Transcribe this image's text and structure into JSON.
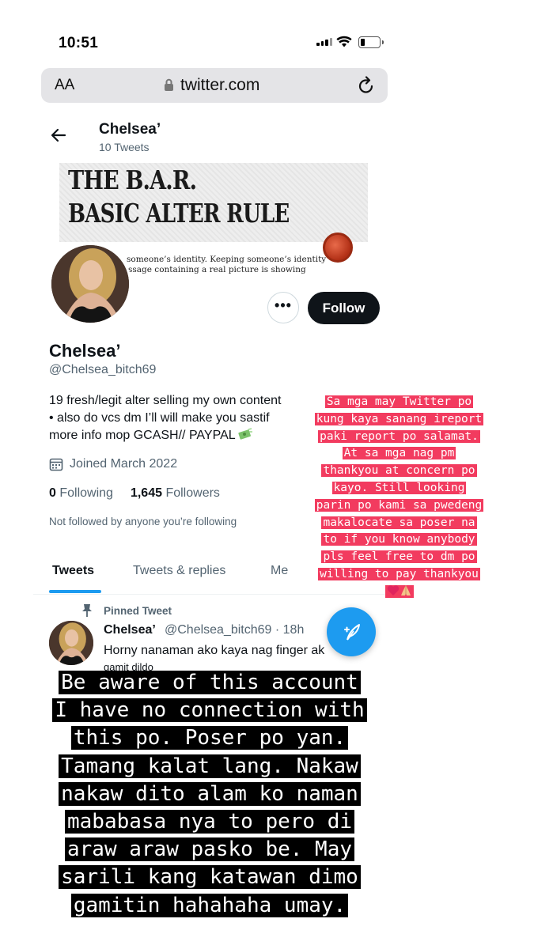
{
  "status_bar": {
    "time": "10:51"
  },
  "browser": {
    "text_size_label": "AA",
    "url": "twitter.com"
  },
  "header": {
    "name": "Chelsea’",
    "tweet_count": "10 Tweets"
  },
  "banner": {
    "line1": "THE B.A.R.",
    "line2": "BASIC ALTER RULE",
    "snippet1": "someone’s identity. Keeping someone’s identity",
    "snippet2": "ssage containing  a real picture is showing"
  },
  "profile": {
    "follow_label": "Follow",
    "more_label": "•••",
    "display_name": "Chelsea’",
    "handle": "@Chelsea_bitch69",
    "bio_line1": "19 fresh/legit alter selling my own content",
    "bio_line2": "• also do vcs dm I’ll will make you sastif",
    "bio_line3": "more info mop GCASH// PAYPAL",
    "joined": "Joined March 2022",
    "following_count": "0",
    "following_label": "Following",
    "followers_count": "1,645",
    "followers_label": "Followers",
    "not_followed": "Not followed by anyone you’re following"
  },
  "tabs": [
    {
      "label": "Tweets"
    },
    {
      "label": "Tweets & replies"
    },
    {
      "label": "Me"
    }
  ],
  "pinned_tweet": {
    "pinned_label": "Pinned Tweet",
    "author": "Chelsea’",
    "meta": "@Chelsea_bitch69 · 18h",
    "text": "Horny nanaman ako kaya nag finger ak",
    "text2": "gamit dildo"
  },
  "story_red_text": [
    "Sa mga may Twitter po",
    "kung kaya sanang ireport",
    "paki report po salamat.",
    "At sa mga nag pm",
    "thankyou at concern po",
    "kayo. Still looking",
    "parin po kami sa pwedeng",
    "makalocate sa poser na",
    "to if you know anybody",
    "pls feel free to dm po",
    "willing to pay thankyou"
  ],
  "story_black_text": [
    "Be aware of this account",
    "I have no connection with",
    "this po. Poser po yan.",
    "Tamang kalat lang. Nakaw",
    "nakaw dito alam ko naman",
    "mababasa nya to pero di",
    "araw araw pasko be. May",
    "sarili kang katawan dimo",
    "gamitin hahahaha umay."
  ],
  "colors": {
    "accent": "#1d9bf0",
    "story_red": "#f23b5f",
    "story_black": "#000000",
    "follow_button": "#0f1419"
  }
}
